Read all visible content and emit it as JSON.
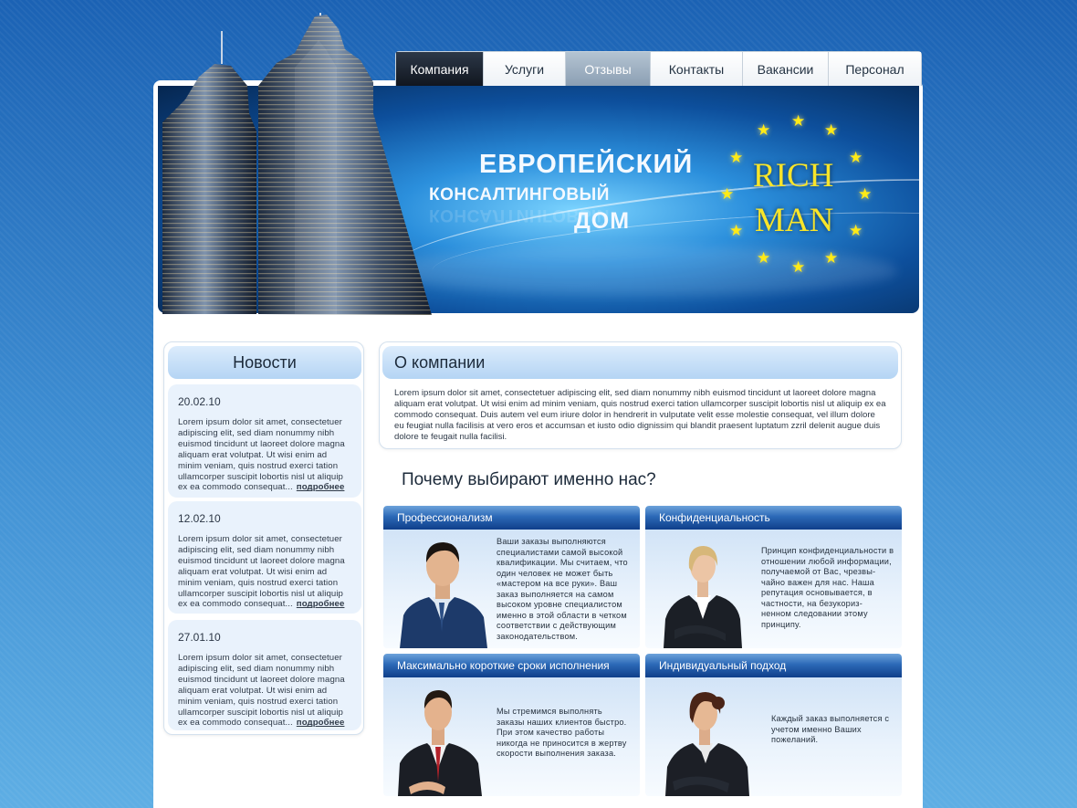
{
  "nav": {
    "tabs": [
      {
        "label": "Компания",
        "state": "active"
      },
      {
        "label": "Услуги",
        "state": "normal"
      },
      {
        "label": "Отзывы",
        "state": "hover"
      },
      {
        "label": "Контакты",
        "state": "normal"
      },
      {
        "label": "Вакансии",
        "state": "normal"
      },
      {
        "label": "Персонал",
        "state": "normal"
      }
    ]
  },
  "banner": {
    "slogan_line1": "ЕВРОПЕЙСКИЙ",
    "slogan_line2": "КОНСАЛТИНГОВЫЙ",
    "slogan_line3": "ДОМ",
    "logo_line1": "RICH",
    "logo_line2": "MAN",
    "logo_color": "#f8e52a"
  },
  "news": {
    "title": "Новости",
    "more_label": "подробнее",
    "items": [
      {
        "date": "20.02.10",
        "text": "Lorem ipsum dolor sit amet, consectetuer adipiscing elit, sed diam nonummy nibh euismod tincidunt ut laoreet dolore magna aliquam erat volutpat. Ut wisi enim ad minim veniam, quis nostrud exerci tation ullamcorper suscipit lobortis nisl ut aliquip ex ea commodo consequat..."
      },
      {
        "date": "12.02.10",
        "text": "Lorem ipsum dolor sit amet, consectetuer adipiscing elit, sed diam nonummy nibh euismod tincidunt ut laoreet dolore magna aliquam erat volutpat. Ut wisi enim ad minim veniam, quis nostrud exerci tation ullamcorper suscipit lobortis nisl ut aliquip ex ea commodo consequat..."
      },
      {
        "date": "27.01.10",
        "text": "Lorem ipsum dolor sit amet, consectetuer adipiscing elit, sed diam nonummy nibh euismod tincidunt ut laoreet dolore magna aliquam erat volutpat. Ut wisi enim ad minim veniam, quis nostrud exerci tation ullamcorper suscipit lobortis nisl ut aliquip ex ea commodo consequat..."
      }
    ]
  },
  "about": {
    "title": "О компании",
    "text": "Lorem ipsum dolor sit amet, consectetuer adipiscing elit, sed diam nonummy nibh euismod tincidunt ut laoreet dolore magna aliquam erat volutpat. Ut wisi enim ad minim veniam, quis nostrud exerci tation ullamcorper suscipit lobortis nisl ut aliquip ex ea commodo consequat. Duis autem vel eum iriure dolor in hendrerit in vulputate velit esse molestie consequat, vel illum dolore eu feugiat nulla facilisis at vero eros et accumsan et iusto odio dignissim qui blandit praesent luptatum zzril delenit augue duis dolore te feugait nulla facilisi."
  },
  "why": {
    "title": "Почему выбирают именно нас?"
  },
  "features": [
    {
      "title": "Профессионализм",
      "text": "Ваши заказы выполняются специалистами самой высокой квалификации. Мы считаем, что один человек не может быть «мастером на все руки». Ваш заказ выполняется на самом высоком уровне специалистом именно в этой области в четком соответствии с действующим законодательством.",
      "person": "man-suit-blue"
    },
    {
      "title": "Конфиденциальность",
      "text": "Принцип конфиденциальности в отношении любой информации, получаемой от Вас, чрезвы- чайно важен для нас. Наша репутация основывается, в частности, на безукориз- ненном следовании этому принципу.",
      "person": "woman-blonde"
    },
    {
      "title": "Максимально короткие сроки исполнения",
      "text": "Мы стремимся выполнять заказы наших клиентов быстро. При этом качество работы никогда не приносится в жертву скорости выполнения заказа.",
      "person": "man-red-tie"
    },
    {
      "title": "Индивидуальный подход",
      "text": "Каждый заказ выполняется с учетом именно Ваших пожеланий.",
      "person": "woman-brunette"
    }
  ]
}
